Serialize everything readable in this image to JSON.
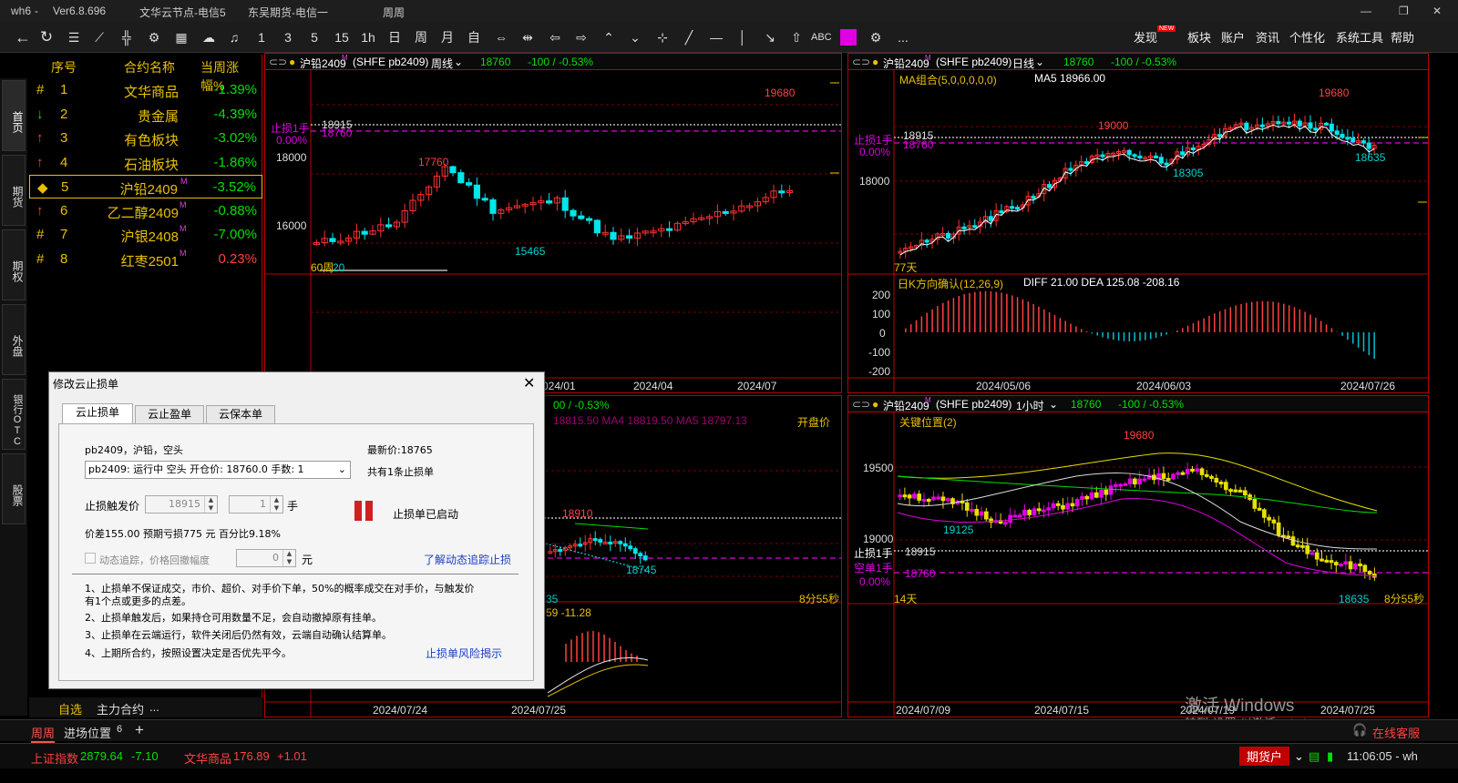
{
  "titlebar": {
    "app": "wh6",
    "version": "Ver6.8.696",
    "server1": "文华云节点-电信5",
    "server2": "东吴期货-电信一",
    "period": "周周"
  },
  "toolbar": {
    "periods": [
      "1",
      "3",
      "5",
      "15",
      "1h",
      "日",
      "周",
      "月",
      "自"
    ],
    "abc": "ABC",
    "menus": [
      "发现",
      "板块",
      "账户",
      "资讯",
      "个性化",
      "系统工具",
      "帮助"
    ],
    "new_badge": "NEW",
    "more": "..."
  },
  "left_tabs": [
    "首页",
    "期货",
    "期权",
    "外盘",
    "银行OTC",
    "股票"
  ],
  "watchlist": {
    "headers": [
      "序号",
      "合约名称",
      "当周涨幅%"
    ],
    "rows": [
      {
        "mark": "#",
        "no": "1",
        "name": "文华商品",
        "sup": "",
        "change": "-1.39%",
        "up": false
      },
      {
        "mark": "↓",
        "no": "2",
        "name": "贵金属",
        "sup": "",
        "change": "-4.39%",
        "up": false
      },
      {
        "mark": "↑",
        "no": "3",
        "name": "有色板块",
        "sup": "",
        "change": "-3.02%",
        "up": false
      },
      {
        "mark": "↑",
        "no": "4",
        "name": "石油板块",
        "sup": "",
        "change": "-1.86%",
        "up": false
      },
      {
        "mark": "◆",
        "no": "5",
        "name": "沪铅2409",
        "sup": "M",
        "change": "-3.52%",
        "up": false
      },
      {
        "mark": "↑",
        "no": "6",
        "name": "乙二醇2409",
        "sup": "M",
        "change": "-0.88%",
        "up": false
      },
      {
        "mark": "#",
        "no": "7",
        "name": "沪银2408",
        "sup": "M",
        "change": "-7.00%",
        "up": false
      },
      {
        "mark": "#",
        "no": "8",
        "name": "红枣2501",
        "sup": "M",
        "change": "0.23%",
        "up": true
      }
    ],
    "bottom_tabs": [
      "自选",
      "主力合约",
      "..."
    ]
  },
  "panel_tl": {
    "title": "沪铅2409",
    "sup": "M",
    "exchange": "(SHFE pb2409)",
    "period": "周线",
    "price": "18760",
    "change": "-100 / -0.53%",
    "y_ticks": [
      "18000",
      "16000"
    ],
    "x_ticks": [
      "024/01",
      "2024/04",
      "2024/07"
    ],
    "stop_label": "止损1手",
    "pct": "0.00%",
    "level_18915": "18915",
    "level_18760": "18760",
    "annotations": {
      "high": "19680",
      "h2": "17760",
      "low": "15465",
      "start": "60周",
      "start_low": "20"
    }
  },
  "panel_tr": {
    "title": "沪铅2409",
    "sup": "M",
    "exchange": "(SHFE pb2409)",
    "period": "日线",
    "price": "18760",
    "change": "-100 / -0.53%",
    "ma_label": "MA组合(5,0,0,0,0,0)",
    "ma5": "MA5 18966.00",
    "y_ticks": [
      "18000"
    ],
    "stop_label": "止损1手",
    "pct": "0.00%",
    "level_18915": "18915",
    "level_18760": "18760",
    "annotations": {
      "high": "19680",
      "h2": "19000",
      "low1": "18305",
      "low2": "18635",
      "start": "77天"
    },
    "macd_label": "日K方向确认(12,26,9)",
    "macd_vals": "DIFF 21.00  DEA 125.08  -208.16",
    "macd_ticks": [
      "200",
      "100",
      "0",
      "-100",
      "-200"
    ],
    "x_ticks": [
      "2024/05/06",
      "2024/06/03",
      "2024/07/26"
    ]
  },
  "panel_bl": {
    "change": "00 / -0.53%",
    "ma_line": "18815.50  MA4 18819.50  MA5 18797.13",
    "kaipan": "开盘价",
    "high": "18910",
    "low": "18745",
    "time": "8分55秒",
    "v35": "35",
    "macd_vals": "59   -11.28",
    "x_ticks": [
      "2024/07/24",
      "2024/07/25"
    ]
  },
  "panel_br": {
    "title": "沪铅2409",
    "sup": "M",
    "exchange": "(SHFE pb2409)",
    "period": "1小时",
    "price": "18760",
    "change": "-100 / -0.53%",
    "indicator": "关键位置(2)",
    "y_ticks": [
      "19500",
      "19000"
    ],
    "stop_label": "止损1手",
    "short_label": "空单1手",
    "pct": "0.00%",
    "level_18915": "18915",
    "level_18760": "18760",
    "annotations": {
      "high": "19680",
      "low1": "19125",
      "low2": "18635",
      "start": "14天"
    },
    "time": "8分55秒",
    "x_ticks": [
      "2024/07/09",
      "2024/07/15",
      "2024/07/19",
      "2024/07/25"
    ]
  },
  "dialog": {
    "title": "修改云止损单",
    "tabs": [
      "云止损单",
      "云止盈单",
      "云保本单"
    ],
    "contract": "pb2409，沪铅，空头",
    "latest": "最新价:18765",
    "select": "pb2409: 运行中 空头 开仓价: 18760.0 手数: 1",
    "count": "共有1条止损单",
    "trigger_label": "止损触发价",
    "trigger_value": "18915",
    "qty_value": "1",
    "qty_unit": "手",
    "status": "止损单已启动",
    "calc": "价差155.00  预期亏损775 元  百分比9.18%",
    "trail_label": "动态追踪，价格回撤幅度",
    "trail_value": "0",
    "trail_unit": "元",
    "trail_link": "了解动态追踪止损",
    "notes": [
      "1、止损单不保证成交，市价、超价、对手价下单，50%的概率成交在对手价，与触发价",
      "有1个点或更多的点差。",
      "2、止损单触发后，如果持仓可用数量不足，会自动撤掉原有挂单。",
      "3、止损单在云端运行，软件关闭后仍然有效，云端自动确认结算单。",
      "4、上期所合约，按照设置决定是否优先平今。"
    ],
    "risk_link": "止损单风险揭示"
  },
  "bottom_tabs": {
    "t1": "周周",
    "t2": "进场位置",
    "t2_count": "6",
    "add": "+"
  },
  "watermark": {
    "line1": "激活 Windows",
    "line2": "转到\"设置\"以激活 Windows。"
  },
  "online_service": "在线客服",
  "status": {
    "index_name": "上证指数",
    "index_val": "2879.64",
    "index_chg": "-7.10",
    "wh_name": "文华商品",
    "wh_val": "176.89",
    "wh_chg": "+1.01",
    "account": "期货户",
    "time": "11:06:05 - wh"
  }
}
